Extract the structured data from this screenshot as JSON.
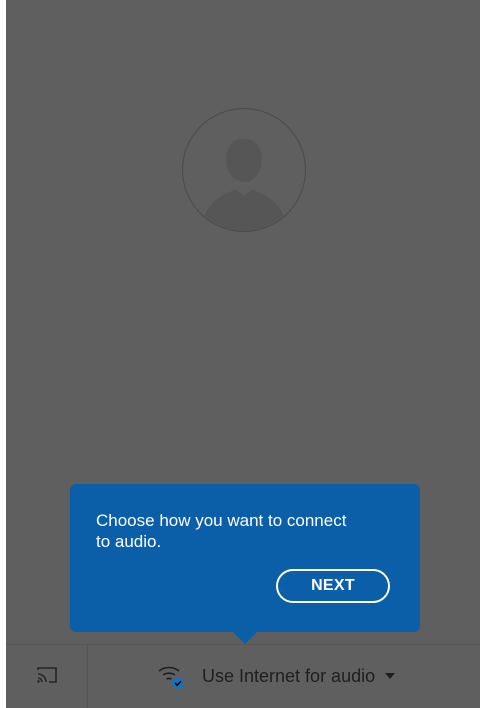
{
  "tooltip": {
    "message": "Choose how you want to connect to audio.",
    "next_label": "NEXT"
  },
  "bottom_bar": {
    "audio_option_label": "Use Internet for audio"
  },
  "icons": {
    "avatar": "person-silhouette-icon",
    "cast": "cast-icon",
    "wifi": "wifi-audio-icon",
    "dropdown": "caret-down-icon"
  },
  "colors": {
    "overlay": "#5f5f5f",
    "tooltip": "#0b5ea8",
    "text_on_tooltip": "#ffffff"
  }
}
